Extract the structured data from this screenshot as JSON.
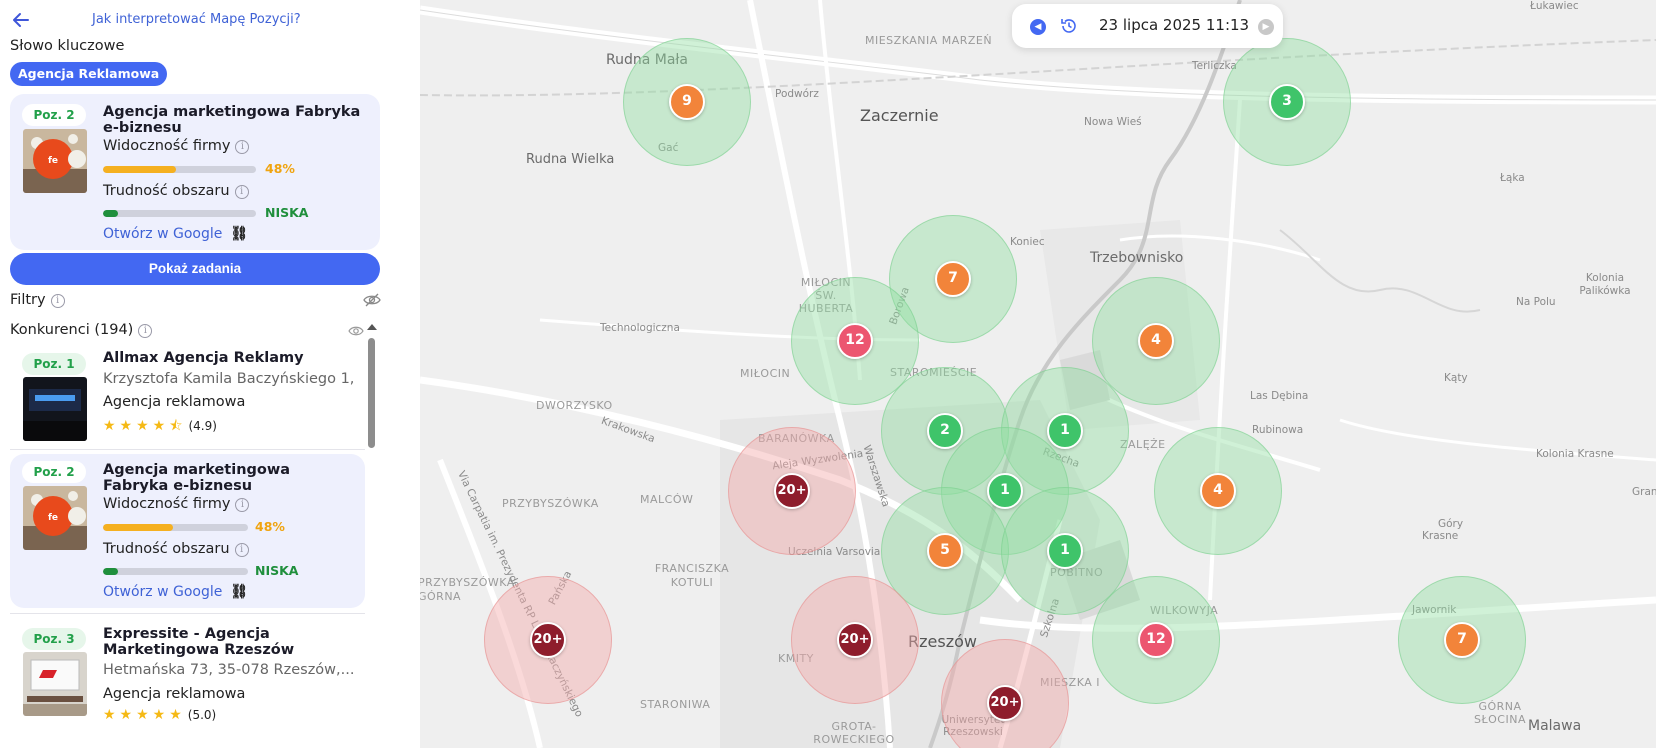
{
  "header": {
    "help_link": "Jak interpretować Mapę Pozycji?"
  },
  "keyword": {
    "title": "Słowo kluczowe",
    "chip": "Agencja Reklamowa"
  },
  "main_card": {
    "position": "Poz. 2",
    "name": "Agencja marketingowa Fabryka e-biznesu",
    "visibility_label": "Widoczność firmy",
    "visibility_value": "48%",
    "visibility_fraction": 0.48,
    "difficulty_label": "Trudność obszaru",
    "difficulty_value": "NISKA",
    "difficulty_fraction": 0.1,
    "google_link": "Otwórz w Google"
  },
  "show_tasks_label": "Pokaż zadania",
  "filters_label": "Filtry",
  "competitors_label": "Konkurenci (194)",
  "competitors": [
    {
      "position": "Poz. 1",
      "name": "Allmax Agencja Reklamy",
      "address": "Krzysztofa Kamila Baczyńskiego 1,...",
      "category": "Agencja reklamowa",
      "stars": "★★★★⯪",
      "rating": "(4.9)"
    },
    {
      "position": "Poz. 2",
      "name": "Agencja marketingowa Fabryka e-biznesu",
      "visibility_label": "Widoczność firmy",
      "visibility_value": "48%",
      "visibility_fraction": 0.48,
      "difficulty_label": "Trudność obszaru",
      "difficulty_value": "NISKA",
      "difficulty_fraction": 0.1,
      "google_link": "Otwórz w Google"
    },
    {
      "position": "Poz. 3",
      "name": "Expressite - Agencja Marketingowa Rzeszów",
      "address": "Hetmańska 73, 35-078 Rzeszów,...",
      "category": "Agencja reklamowa",
      "stars": "★★★★★",
      "rating": "(5.0)"
    }
  ],
  "datebar": {
    "date": "23 lipca 2025 11:13"
  },
  "map_labels": {
    "rudna_mala": "Rudna Mała",
    "gac": "Gać",
    "podwor": "Podwórz",
    "osiedlowa": "Osiedlowa",
    "mieszkania_marzen": "MIESZKANIA MARZEŃ",
    "zaczernie": "Zaczernie",
    "rudna_wielka": "Rudna Wielka",
    "terliczka": "Terliczka",
    "nowa_wies": "Nowa Wieś",
    "laka": "Łąka",
    "lukawiec": "Łukawiec",
    "koniec": "Koniec",
    "trzebownisko": "Trzebownisko",
    "milocin_sw_huberta": "MIŁOCIN ŚW. HUBERTA",
    "technologiczna": "Technologiczna",
    "biorowa": "Borowa",
    "staromiescie": "STAROMIEŚCIE",
    "milocin": "MIŁOCIN",
    "dworzysko": "DWORZYSKO",
    "krakowska": "Krakowska",
    "baranowka": "BARANÓWKA",
    "aleja_wyzwolenia": "Aleja Wyzwolenia",
    "warszawska": "Warszawska",
    "przybyszowka": "PRZYBYSZÓWKA",
    "malcow": "MALCÓW",
    "uczelnia_varsovia": "Uczelnia Varsovia",
    "franciszka_kotuli": "FRANCISZKA KOTULI",
    "przybyszowka_gorna": "PRZYBYSZÓWKA GÓRNA",
    "via_carpatia": "Via Carpatia im. Prezydenta RP Lecha Kaczyńskiego",
    "panska": "Pańska",
    "rzeszow": "Rzeszów",
    "kmity": "KMITY",
    "staroniwa": "STARONIWA",
    "grota_roweckiego": "GROTA-ROWECKIEGO",
    "uniwersytet_rzeszowski": "Uniwersytet Rzeszowski",
    "mieszka_i": "MIESZKA I",
    "pobitno": "POBITNO",
    "wilkowyja": "WILKOWYJA",
    "zalęze": "ZALĘŻE",
    "rzecha": "Rzecha",
    "las_debina": "Las Dębina",
    "rubinowa": "Rubinowa",
    "katy": "Kąty",
    "na_polu": "Na Polu",
    "kolonia_palikowka": "Kolonia Palikówka",
    "kolonia_krasne": "Kolonia Krasne",
    "gory": "Góry",
    "krasne": "Krasne",
    "jawornik": "Jawornik",
    "gorna_slocina": "GÓRNA SŁOCINA",
    "malawa": "Malawa",
    "szkolna": "Szkolna",
    "gran": "Gran"
  },
  "grid_pins": [
    {
      "label": "9",
      "color": "orange",
      "zone": "g"
    },
    {
      "label": "3",
      "color": "green",
      "zone": "g"
    },
    {
      "label": "7",
      "color": "orange",
      "zone": "g"
    },
    {
      "label": "12",
      "color": "pink",
      "zone": "g"
    },
    {
      "label": "4",
      "color": "orange",
      "zone": "g"
    },
    {
      "label": "2",
      "color": "green",
      "zone": "g"
    },
    {
      "label": "1",
      "color": "green",
      "zone": "g"
    },
    {
      "label": "20+",
      "color": "dark",
      "zone": "r"
    },
    {
      "label": "1",
      "color": "green",
      "zone": "g"
    },
    {
      "label": "4",
      "color": "orange",
      "zone": "g"
    },
    {
      "label": "5",
      "color": "orange",
      "zone": "g"
    },
    {
      "label": "1",
      "color": "green",
      "zone": "g"
    },
    {
      "label": "20+",
      "color": "dark",
      "zone": "r"
    },
    {
      "label": "20+",
      "color": "dark",
      "zone": "r"
    },
    {
      "label": "12",
      "color": "pink",
      "zone": "g"
    },
    {
      "label": "7",
      "color": "orange",
      "zone": "g"
    },
    {
      "label": "20+",
      "color": "dark",
      "zone": "r"
    }
  ],
  "colors": {
    "accent": "#4368f2",
    "green_pin": "#3fc46a",
    "orange_pin": "#f2843a",
    "pink_pin": "#ec5670",
    "dark_pin": "#8e1d2c",
    "visibility_bar": "#f5b020",
    "difficulty_bar": "#1f8f3c"
  }
}
